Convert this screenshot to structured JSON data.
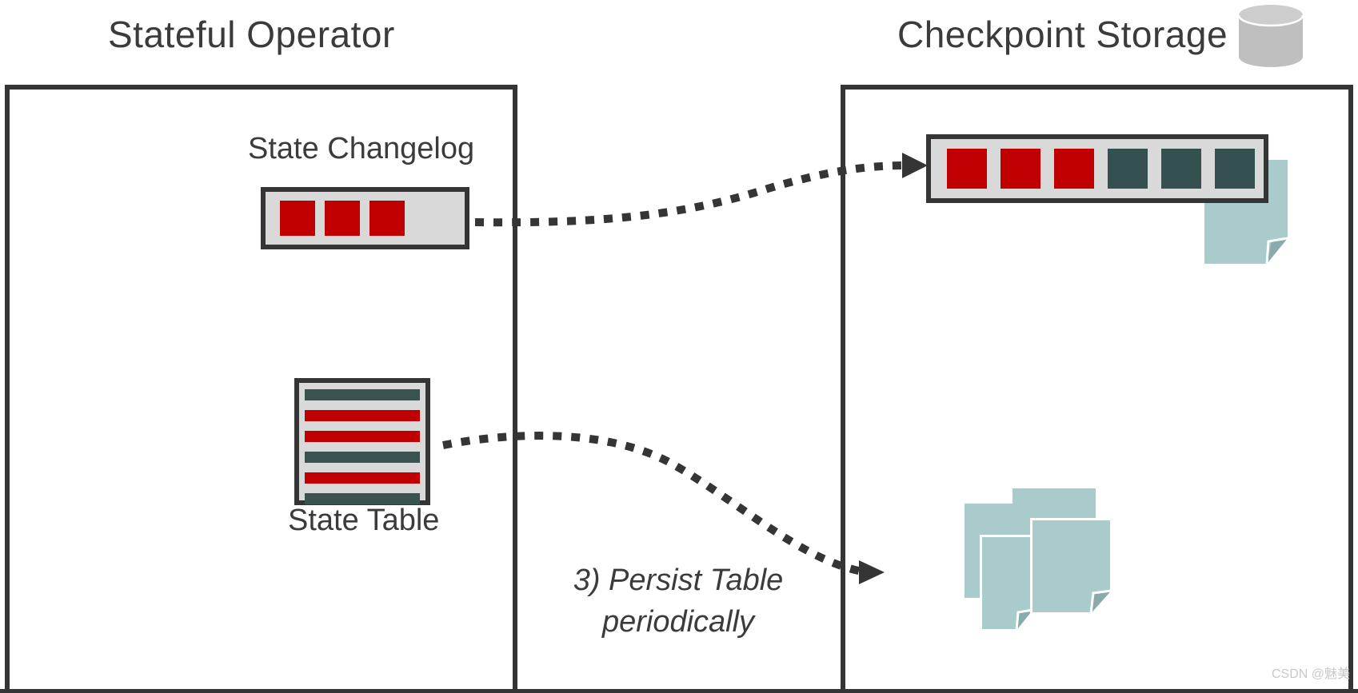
{
  "diagram": {
    "title_left": "Stateful Operator",
    "title_right": "Checkpoint Storage",
    "caption_line1": "3) Persist Table",
    "caption_line2": "periodically",
    "watermark": "CSDN @魅美"
  },
  "icons": {
    "database": "database-cylinder-icon",
    "document": "document-file-icon",
    "arrow": "dotted-curved-arrow-icon"
  },
  "colors": {
    "red": "#c00000",
    "teal": "#34504f",
    "light_gray": "#d9d9d9",
    "dark_outline": "#353535",
    "doc_teal": "#a9cbcb",
    "doc_fold": "#8aabab",
    "text": "#3b3b3b",
    "db_gray": "#bfbfbf"
  },
  "left_panel": {
    "changelog": {
      "label": "State Changelog",
      "cells": [
        "red",
        "red",
        "red"
      ]
    },
    "state_table": {
      "label": "State Table",
      "rows": [
        "teal",
        "red",
        "red",
        "teal",
        "red",
        "teal"
      ]
    }
  },
  "right_panel": {
    "changelog": {
      "cells": [
        "red",
        "red",
        "red",
        "teal",
        "teal",
        "teal"
      ]
    },
    "documents": {
      "single_count": 1,
      "stack_count": 4
    }
  },
  "arrows": [
    {
      "name": "changelog-replication-arrow",
      "from": "State Changelog",
      "to": "Checkpoint Changelog"
    },
    {
      "name": "table-persist-arrow",
      "from": "State Table",
      "to": "Checkpoint Documents"
    }
  ]
}
